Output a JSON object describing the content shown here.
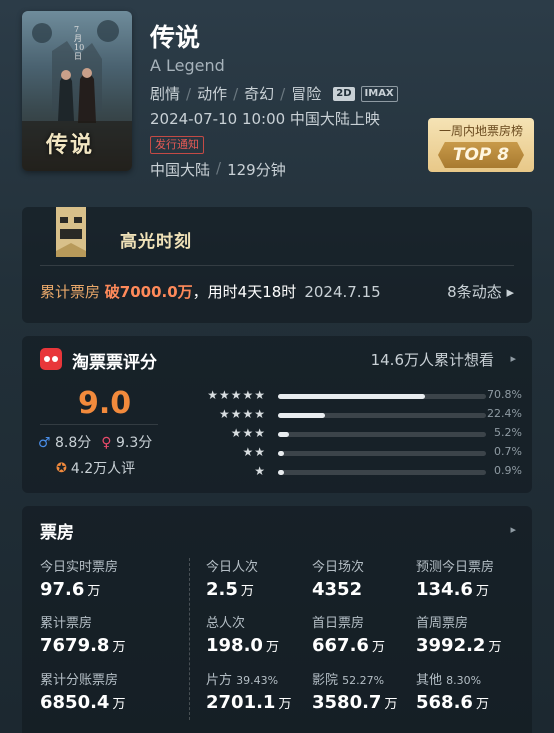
{
  "movie": {
    "title": "传说",
    "english_title": "A Legend",
    "poster_title": "传说",
    "poster_side_text": "7月10日",
    "genres": [
      "剧情",
      "动作",
      "奇幻",
      "冒险"
    ],
    "formats": [
      "2D",
      "IMAX"
    ],
    "release": "2024-07-10 10:00 中国大陆上映",
    "notice_button": "发行通知",
    "region": "中国大陆",
    "duration": "129分钟",
    "rank_badge": {
      "label": "一周内地票房榜",
      "rank": "TOP 8"
    }
  },
  "highlight": {
    "title": "高光时刻",
    "prefix": "累计票房 ",
    "amount": "破7000.0万",
    "time": "，用时4天18时",
    "date": "2024.7.15",
    "more": "8条动态 ▸"
  },
  "rating": {
    "brand": "淘票票评分",
    "want_to_see": "14.6万人累计想看",
    "chevron": "▸",
    "score": "9.0",
    "male_symbol": "♂",
    "male_score": "8.8分",
    "female_symbol": "♀",
    "female_score": "9.3分",
    "reviewer_star": "✪",
    "reviewers": "4.2万人评",
    "distribution": [
      {
        "stars": "★★★★★",
        "percent": "70.8%",
        "value": 70.8
      },
      {
        "stars": "★★★★",
        "percent": "22.4%",
        "value": 22.4
      },
      {
        "stars": "★★★",
        "percent": "5.2%",
        "value": 5.2
      },
      {
        "stars": "★★",
        "percent": "0.7%",
        "value": 0.7
      },
      {
        "stars": "★",
        "percent": "0.9%",
        "value": 0.9
      }
    ]
  },
  "box_office": {
    "title": "票房",
    "chevron": "▸",
    "unit": "万",
    "today_realtime": {
      "label": "今日实时票房",
      "value": "97.6"
    },
    "today_admissions": {
      "label": "今日人次",
      "value": "2.5"
    },
    "today_shows": {
      "label": "今日场次",
      "value": "4352"
    },
    "forecast_today": {
      "label": "预测今日票房",
      "value": "134.6"
    },
    "cumulative": {
      "label": "累计票房",
      "value": "7679.8"
    },
    "total_admissions": {
      "label": "总人次",
      "value": "198.0"
    },
    "opening_day": {
      "label": "首日票房",
      "value": "667.6"
    },
    "opening_week": {
      "label": "首周票房",
      "value": "3992.2"
    },
    "cumulative_split": {
      "label": "累计分账票房",
      "value": "6850.4"
    },
    "producer_share": {
      "label": "片方",
      "pct": "39.43%",
      "value": "2701.1"
    },
    "cinema_share": {
      "label": "影院",
      "pct": "52.27%",
      "value": "3580.7"
    },
    "other_share": {
      "label": "其他",
      "pct": "8.30%",
      "value": "568.6"
    }
  }
}
